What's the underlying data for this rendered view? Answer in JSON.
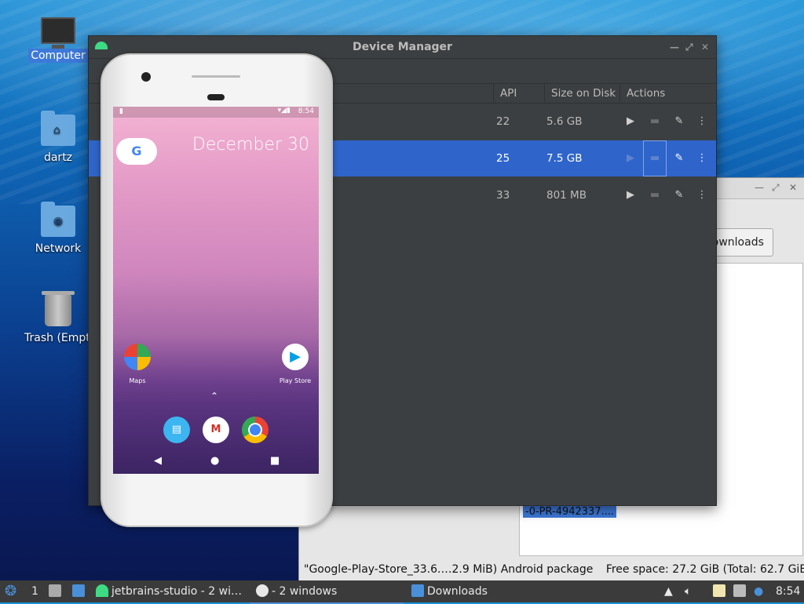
{
  "desktop": {
    "icons": [
      {
        "label": "Computer",
        "icon": "computer-icon"
      },
      {
        "label": "dartz",
        "icon": "home-folder-icon"
      },
      {
        "label": "Network",
        "icon": "network-folder-icon"
      },
      {
        "label": "Trash (Empty)",
        "icon": "trash-icon"
      }
    ]
  },
  "file_window": {
    "downloads_button": "Downloads",
    "selected_text": "-0-PR-4942337....",
    "status_file": "\"Google-Play-Store_33.6.…2.9 MiB) Android package",
    "status_space": "Free space: 27.2 GiB (Total: 62.7 GiB)"
  },
  "device_manager": {
    "title": "Device Manager",
    "columns": {
      "api": "API",
      "size": "Size on Disk",
      "actions": "Actions"
    },
    "rows": [
      {
        "api": "22",
        "size": "5.6 GB",
        "selected": false
      },
      {
        "api": "25",
        "size": "7.5 GB",
        "selected": true
      },
      {
        "api": "33",
        "size": "801 MB",
        "selected": false
      }
    ]
  },
  "phone": {
    "time": "8:54",
    "date": "December 30",
    "google_glyph": "G",
    "apps": [
      {
        "label": "Maps",
        "icon": "maps-icon"
      },
      {
        "label": "Play Store",
        "icon": "play-store-icon"
      }
    ],
    "dock": [
      "messages-icon",
      "gmail-icon",
      "chrome-icon"
    ]
  },
  "taskbar": {
    "workspace": "1",
    "items": [
      {
        "label": "jetbrains-studio - 2 wi…",
        "icon": "android-studio-icon"
      },
      {
        "label": "- 2 windows",
        "icon": "emulator-icon",
        "active": true
      },
      {
        "label": "Downloads",
        "icon": "folder-icon"
      }
    ],
    "clock": "8:54"
  },
  "colors": {
    "dm_bg": "#3c3f41",
    "selection": "#2f65ca",
    "android_green": "#3ddc84"
  }
}
